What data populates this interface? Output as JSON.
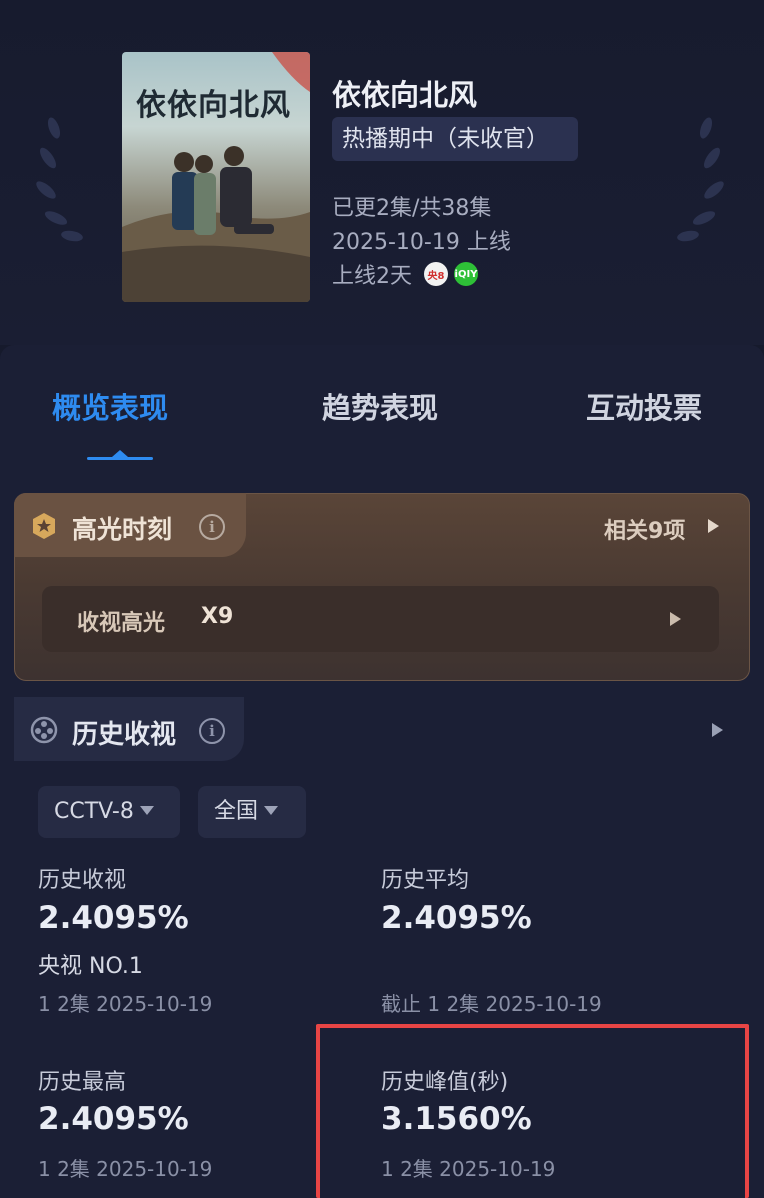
{
  "show": {
    "title": "依依向北风",
    "poster_title": "依依向北风",
    "status": "热播期中（未收官）",
    "episodes": "已更2集/共38集",
    "premiere": "2025-10-19 上线",
    "days_online": "上线2天",
    "channel_icons": [
      {
        "name": "cctv8-icon",
        "text": "央8"
      },
      {
        "name": "iqiyi-icon",
        "text": "iQIY"
      }
    ]
  },
  "tabs": [
    {
      "label": "概览表现",
      "active": true
    },
    {
      "label": "趋势表现",
      "active": false
    },
    {
      "label": "互动投票",
      "active": false
    }
  ],
  "highlights": {
    "title": "高光时刻",
    "related": "相关9项",
    "row_label": "收视高光",
    "row_count": "X9"
  },
  "history": {
    "title": "历史收视",
    "filters": [
      "CCTV-8",
      "全国"
    ],
    "stats": [
      {
        "label": "历史收视",
        "value": "2.4095%",
        "rank": "央视 NO.1",
        "sub": "1 2集 2025-10-19"
      },
      {
        "label": "历史平均",
        "value": "2.4095%",
        "rank": "",
        "sub": "截止 1 2集 2025-10-19"
      },
      {
        "label": "历史最高",
        "value": "2.4095%",
        "rank": "",
        "sub": "1 2集 2025-10-19"
      },
      {
        "label": "历史峰值(秒)",
        "value": "3.1560%",
        "rank": "",
        "sub": "1 2集 2025-10-19"
      }
    ]
  },
  "colors": {
    "background": "#161a2c",
    "accent": "#2e8bf0",
    "highlight_box": "#e84545"
  }
}
